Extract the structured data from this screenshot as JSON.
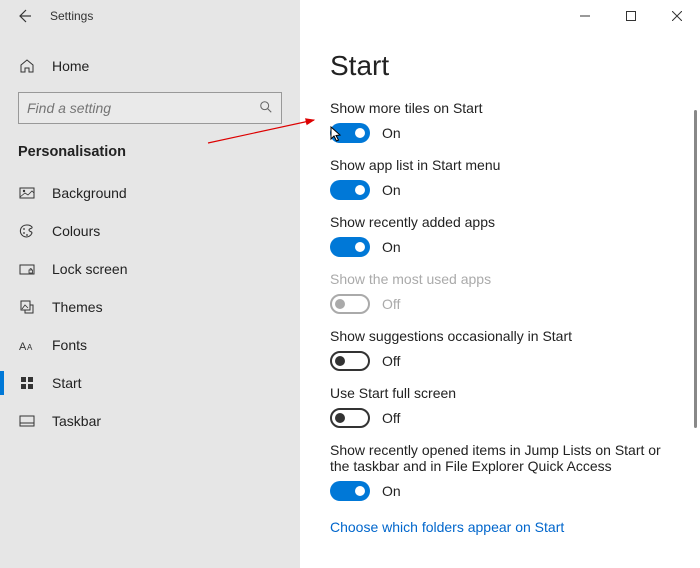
{
  "window": {
    "title": "Settings"
  },
  "sidebar": {
    "home": "Home",
    "search_placeholder": "Find a setting",
    "section": "Personalisation",
    "items": [
      {
        "label": "Background"
      },
      {
        "label": "Colours"
      },
      {
        "label": "Lock screen"
      },
      {
        "label": "Themes"
      },
      {
        "label": "Fonts"
      },
      {
        "label": "Start"
      },
      {
        "label": "Taskbar"
      }
    ]
  },
  "page": {
    "title": "Start",
    "settings": [
      {
        "label": "Show more tiles on Start",
        "state": "On",
        "on": true,
        "disabled": false
      },
      {
        "label": "Show app list in Start menu",
        "state": "On",
        "on": true,
        "disabled": false
      },
      {
        "label": "Show recently added apps",
        "state": "On",
        "on": true,
        "disabled": false
      },
      {
        "label": "Show the most used apps",
        "state": "Off",
        "on": false,
        "disabled": true
      },
      {
        "label": "Show suggestions occasionally in Start",
        "state": "Off",
        "on": false,
        "disabled": false
      },
      {
        "label": "Use Start full screen",
        "state": "Off",
        "on": false,
        "disabled": false
      },
      {
        "label": "Show recently opened items in Jump Lists on Start or the taskbar and in File Explorer Quick Access",
        "state": "On",
        "on": true,
        "disabled": false
      }
    ],
    "link": "Choose which folders appear on Start"
  }
}
